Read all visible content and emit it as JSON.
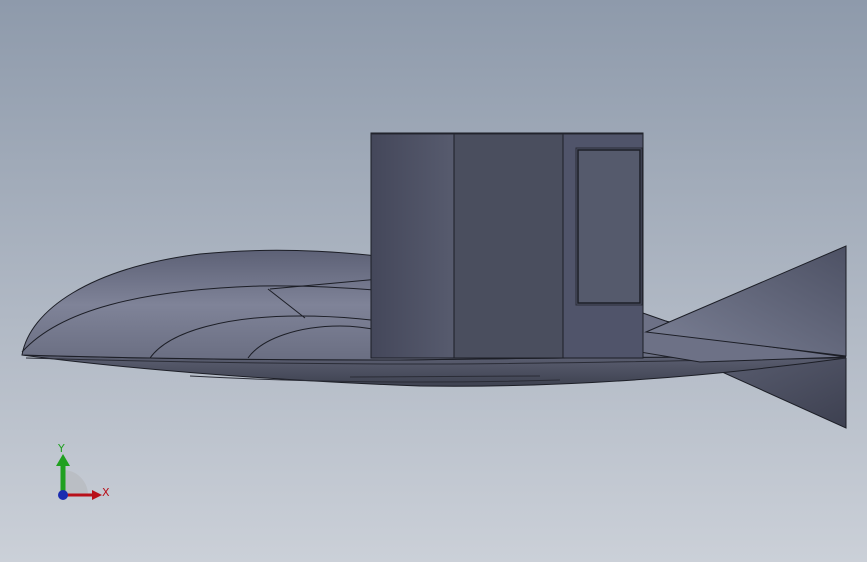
{
  "viewport": {
    "background_top": "#8e9aab",
    "background_bottom": "#c9ced6"
  },
  "model": {
    "hull_color": "#6b6f82",
    "sail_color": "#4a4e5e",
    "edge_color": "#1c1e26"
  },
  "triad": {
    "x_label": "X",
    "y_label": "Y",
    "x_color": "#b8101a",
    "y_color": "#20a020",
    "z_color": "#1a2bb0"
  }
}
